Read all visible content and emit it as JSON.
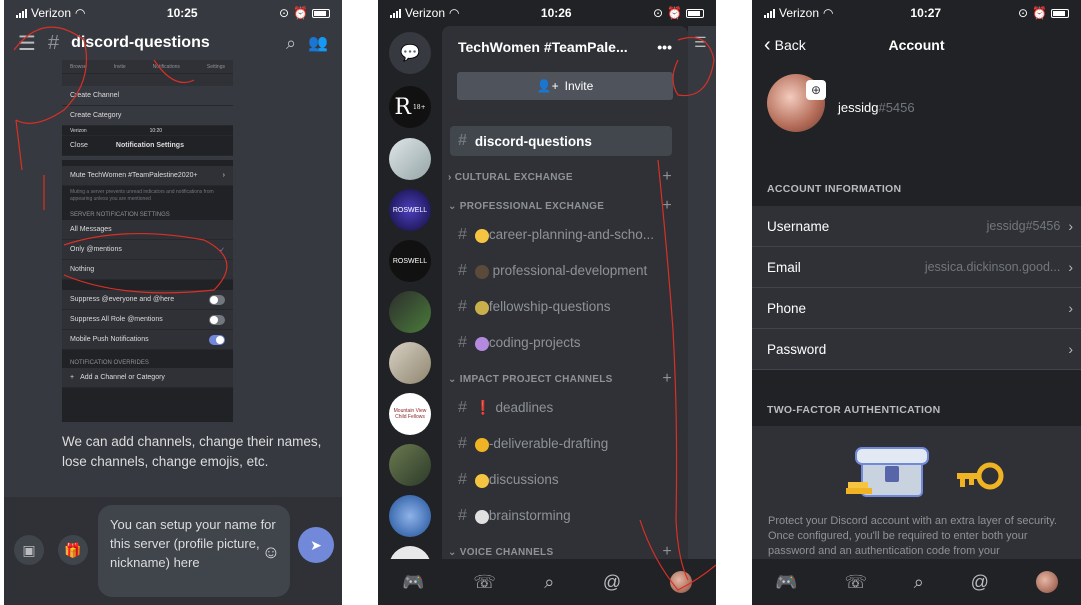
{
  "status": {
    "carrier": "Verizon",
    "time_1": "10:25",
    "time_2": "10:26",
    "time_3": "10:27"
  },
  "phone1": {
    "channel": "discord-questions",
    "mini": {
      "tabs": [
        "Browse",
        "Invite",
        "Notifications",
        "Settings"
      ],
      "create_channel": "Create Channel",
      "create_category": "Create Category",
      "status_carrier": "Verizon",
      "status_time": "10:20",
      "close": "Close",
      "title": "Notification Settings",
      "mute": "Mute TechWomen #TeamPalestine2020+",
      "mute_desc": "Muting a server prevents unread indicators and notifications from appearing unless you are mentioned",
      "server_label": "SERVER NOTIFICATION SETTINGS",
      "all_messages": "All Messages",
      "only_mentions": "Only @mentions",
      "nothing": "Nothing",
      "suppress_everyone": "Suppress @everyone and @here",
      "suppress_roles": "Suppress All Role @mentions",
      "mobile_push": "Mobile Push Notifications",
      "overrides_label": "NOTIFICATION OVERRIDES",
      "add_channel": "Add a Channel or Category"
    },
    "note": "We can add channels, change their names, lose channels, change emojis, etc.",
    "composer_text": "You can setup your name for this server (profile picture, nickname) here"
  },
  "phone2": {
    "guild_name": "TechWomen #TeamPale...",
    "invite": "Invite",
    "selected_channel": "discord-questions",
    "categories": {
      "cultural": "CULTURAL EXCHANGE",
      "professional": "PROFESSIONAL EXCHANGE",
      "impact": "IMPACT PROJECT CHANNELS",
      "voice": "VOICE CHANNELS"
    },
    "channels": {
      "career": "career-planning-and-scho...",
      "prodev": "professional-development",
      "fellowship": "fellowship-questions",
      "coding": "coding-projects",
      "deadlines": "deadlines",
      "deliverable": "-deliverable-drafting",
      "discussions": "discussions",
      "brainstorming": "brainstorming"
    },
    "guild_labels": {
      "r": "R",
      "r_badge": "18+",
      "roswell1": "ROSWELL",
      "roswell2": "ROSWELL",
      "mountain": "Mountain View Child Fellows"
    }
  },
  "phone3": {
    "back": "Back",
    "title": "Account",
    "username": "jessidg",
    "tag": "#5456",
    "account_label": "ACCOUNT INFORMATION",
    "rows": {
      "username_label": "Username",
      "username_value": "jessidg#5456",
      "email_label": "Email",
      "email_value": "jessica.dickinson.good...",
      "phone_label": "Phone",
      "password_label": "Password"
    },
    "tfa_label": "TWO-FACTOR AUTHENTICATION",
    "tfa_text": "Protect your Discord account with an extra layer of security. Once configured, you'll be required to enter both your password and an authentication code from your"
  },
  "colors": {
    "bg_dark": "#202225",
    "bg_main": "#36393f",
    "bg_panel": "#2f3136",
    "blurple": "#7289da",
    "annotation_red": "#d93025"
  }
}
